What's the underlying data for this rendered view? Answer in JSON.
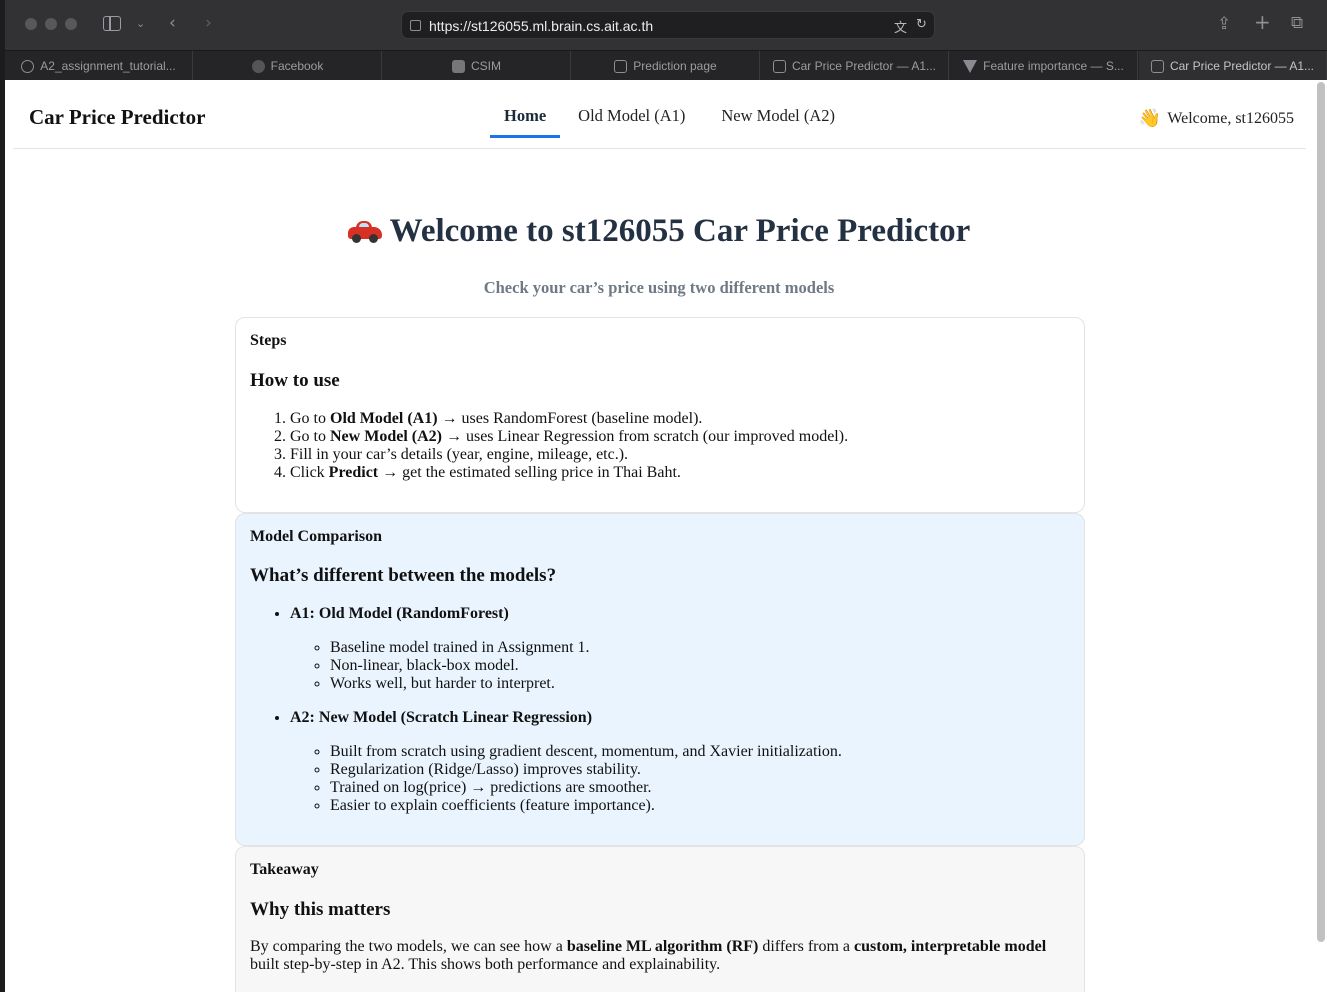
{
  "browser": {
    "url": "https://st126055.ml.brain.cs.ait.ac.th",
    "tabs": [
      {
        "label": "A2_assignment_tutorial...",
        "icon": "google-icon"
      },
      {
        "label": "Facebook",
        "icon": "facebook-icon"
      },
      {
        "label": "CSIM",
        "icon": "csim-icon"
      },
      {
        "label": "Prediction page",
        "icon": "page-icon"
      },
      {
        "label": "Car Price Predictor — A1...",
        "icon": "page-icon"
      },
      {
        "label": "Feature importance — S...",
        "icon": "streamlit-icon"
      },
      {
        "label": "Car Price Predictor — A1...",
        "icon": "page-icon",
        "active": true
      }
    ]
  },
  "nav": {
    "brand": "Car Price Predictor",
    "tabs": [
      "Home",
      "Old Model (A1)",
      "New Model (A2)"
    ],
    "active_tab": "Home",
    "welcome": "Welcome, st126055",
    "accent": "#1a73e8"
  },
  "hero": {
    "title": "Welcome to st126055 Car Price Predictor",
    "subtitle": "Check your car’s price using two different models"
  },
  "steps": {
    "label": "Steps",
    "heading": "How to use",
    "items": [
      {
        "pre": "Go to ",
        "bold": "Old Model (A1)",
        "post": " → uses RandomForest (baseline model)."
      },
      {
        "pre": "Go to ",
        "bold": "New Model (A2)",
        "post": " → uses Linear Regression from scratch (our improved model)."
      },
      {
        "pre": "Fill in your car’s details (year, engine, mileage, etc.).",
        "bold": "",
        "post": ""
      },
      {
        "pre": "Click ",
        "bold": "Predict",
        "post": " → get the estimated selling price in Thai Baht."
      }
    ]
  },
  "comparison": {
    "label": "Model Comparison",
    "heading": "What’s different between the models?",
    "background": "#eaf4fe",
    "models": [
      {
        "title": "A1: Old Model (RandomForest)",
        "points": [
          "Baseline model trained in Assignment 1.",
          "Non-linear, black-box model.",
          "Works well, but harder to interpret."
        ]
      },
      {
        "title": "A2: New Model (Scratch Linear Regression)",
        "points": [
          "Built from scratch using gradient descent, momentum, and Xavier initialization.",
          "Regularization (Ridge/Lasso) improves stability.",
          "Trained on log(price) → predictions are smoother.",
          "Easier to explain coefficients (feature importance)."
        ]
      }
    ]
  },
  "takeaway": {
    "label": "Takeaway",
    "heading": "Why this matters",
    "text_1": "By comparing the two models, we can see how a ",
    "bold_1": "baseline ML algorithm (RF)",
    "text_2": " differs from a ",
    "bold_2": "custom, interpretable model",
    "text_3": " built step-by-step in A2. This shows both performance and explainability."
  }
}
